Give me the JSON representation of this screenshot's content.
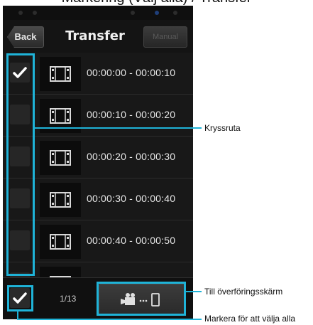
{
  "page": {
    "heading": "Markering (Välj alla) / Transfer"
  },
  "header": {
    "back_label": "Back",
    "title": "Transfer",
    "manual_label": "Manual"
  },
  "list": {
    "items": [
      {
        "time_range": "00:00:00 - 00:00:10",
        "checked": true
      },
      {
        "time_range": "00:00:10 - 00:00:20",
        "checked": false
      },
      {
        "time_range": "00:00:20 - 00:00:30",
        "checked": false
      },
      {
        "time_range": "00:00:30 - 00:00:40",
        "checked": false
      },
      {
        "time_range": "00:00:40 - 00:00:50",
        "checked": false
      },
      {
        "time_range": "",
        "checked": false
      }
    ]
  },
  "footer": {
    "page_indicator": "1/13",
    "select_all_checked": true,
    "transfer_icon": "camera-to-phone-icon"
  },
  "callouts": {
    "checkbox": "Kryssruta",
    "transfer_screen": "Till överföringsskärm",
    "select_all": "Markera för att välja alla"
  },
  "colors": {
    "highlight": "#1fb3d8",
    "background": "#1b1b1b"
  }
}
